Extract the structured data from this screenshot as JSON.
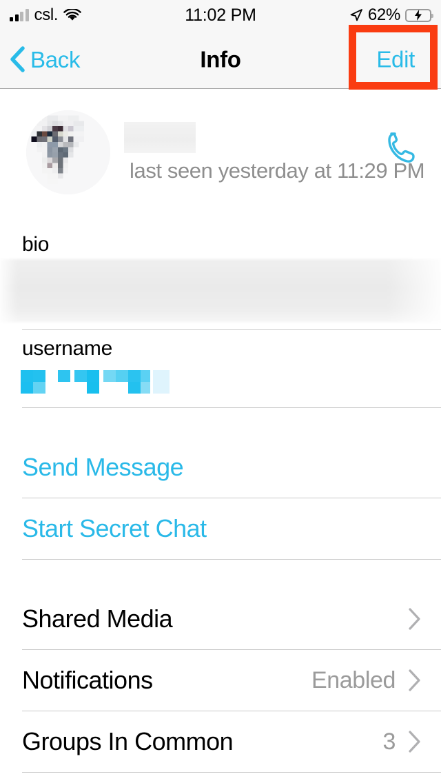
{
  "status_bar": {
    "carrier": "csl.",
    "time": "11:02 PM",
    "battery_percent": "62%",
    "icons": {
      "signal": "signal-bars-icon",
      "wifi": "wifi-icon",
      "location": "location-arrow-icon",
      "battery": "battery-charging-icon"
    }
  },
  "nav_bar": {
    "back_label": "Back",
    "title": "Info",
    "edit_label": "Edit"
  },
  "annotation": {
    "color": "#fa3c11",
    "target": "edit-button"
  },
  "profile": {
    "name": "",
    "name_redacted": true,
    "status": "last seen yesterday at 11:29 PM",
    "avatar_redacted": true,
    "call_icon": "phone-call-icon"
  },
  "fields": [
    {
      "label": "bio",
      "value": "",
      "redacted": true
    },
    {
      "label": "username",
      "value": "",
      "redacted": true
    }
  ],
  "actions": [
    {
      "label": "Send Message",
      "name": "send-message-action"
    },
    {
      "label": "Start Secret Chat",
      "name": "start-secret-chat-action"
    }
  ],
  "list_rows": [
    {
      "label": "Shared Media",
      "value": "",
      "name": "shared-media-row"
    },
    {
      "label": "Notifications",
      "value": "Enabled",
      "name": "notifications-row"
    },
    {
      "label": "Groups In Common",
      "value": "3",
      "name": "groups-in-common-row"
    }
  ],
  "colors": {
    "accent": "#29bbe8",
    "highlight": "#fa3c11",
    "nav_background": "#f7f7f7",
    "secondary_text": "#9b9b9b",
    "battery_green": "#2fd157"
  }
}
